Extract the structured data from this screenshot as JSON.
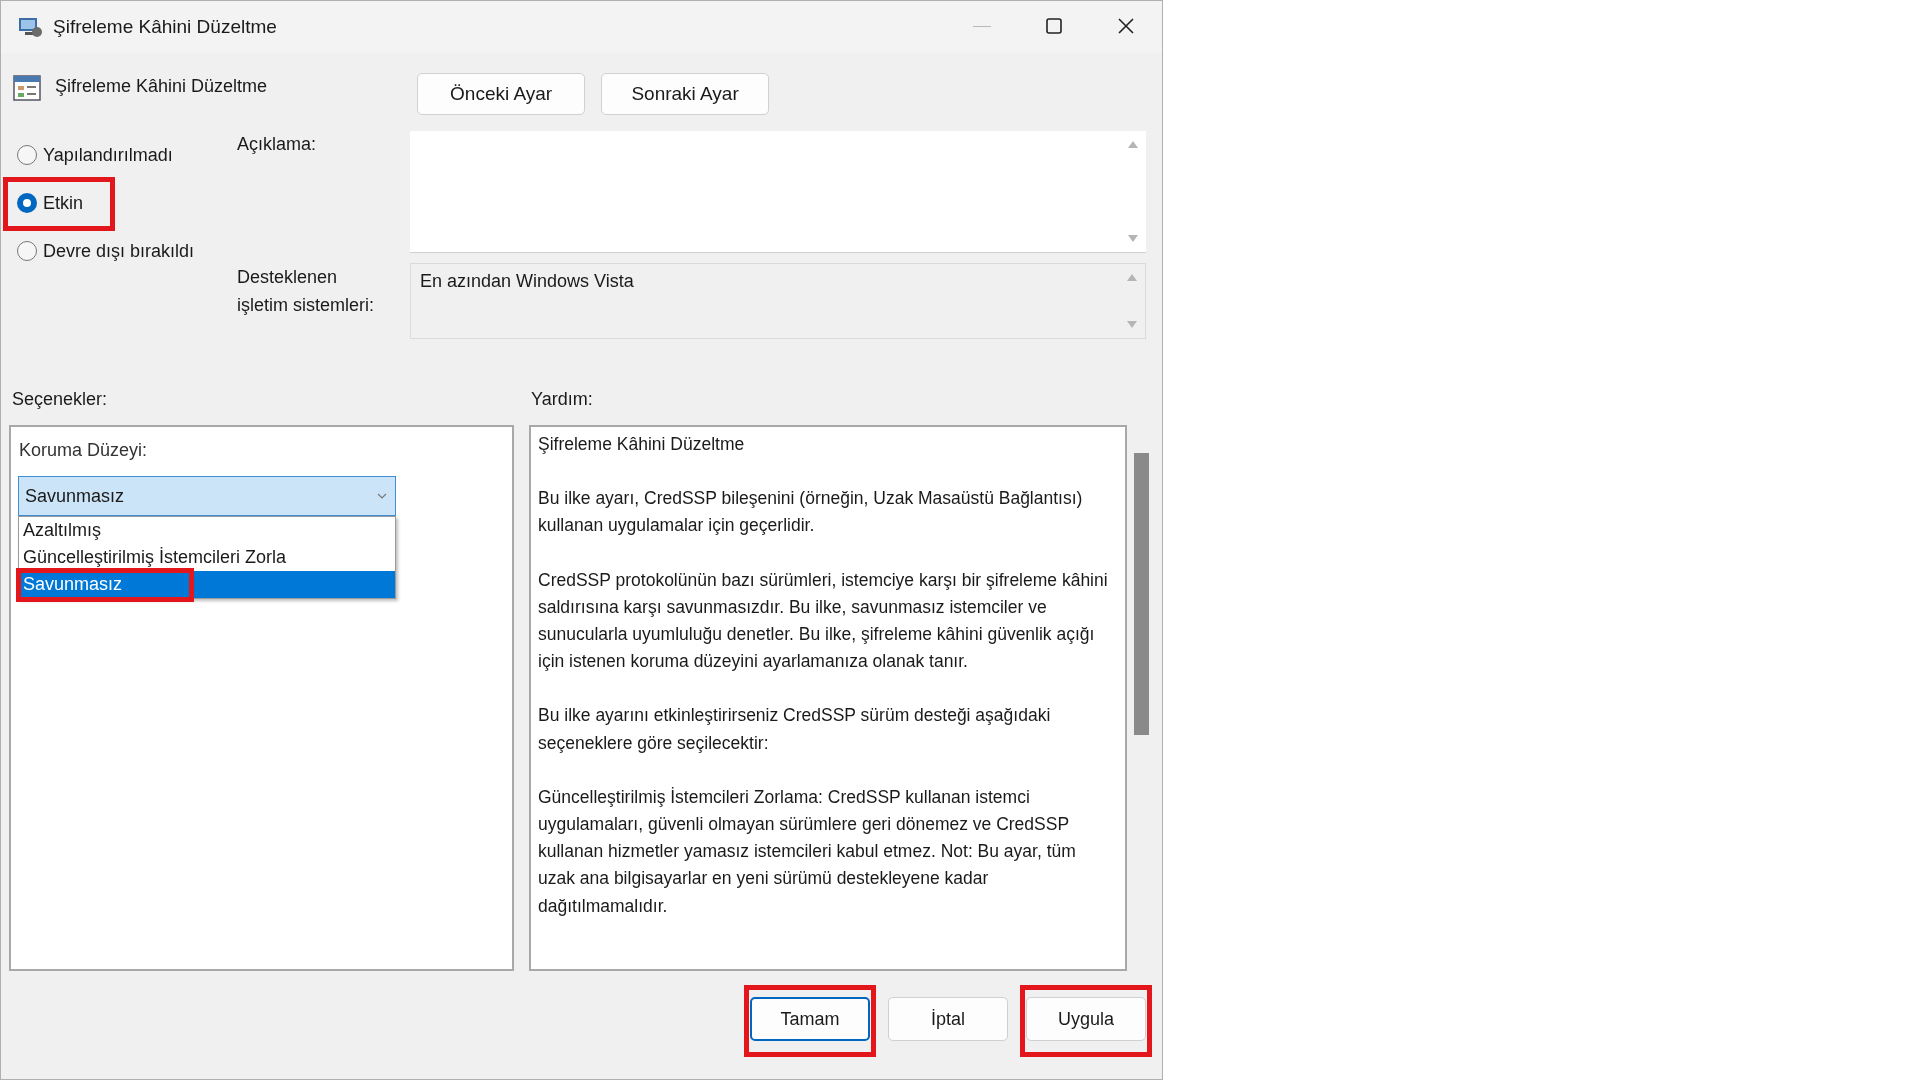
{
  "window": {
    "title": "Şifreleme Kâhini Düzeltme"
  },
  "setting_title": "Şifreleme Kâhini Düzeltme",
  "nav_buttons": [
    "Önceki Ayar",
    "Sonraki Ayar"
  ],
  "state_options": [
    {
      "label": "Yapılandırılmadı",
      "selected": false,
      "highlighted": false
    },
    {
      "label": "Etkin",
      "selected": true,
      "highlighted": true
    },
    {
      "label": "Devre dışı bırakıldı",
      "selected": false,
      "highlighted": false
    }
  ],
  "comment": {
    "label": "Açıklama:"
  },
  "supported": {
    "label": "Desteklenen işletim sistemleri:",
    "value": "En azından Windows Vista"
  },
  "options": {
    "label": "Seçenekler:",
    "field_label": "Koruma Düzeyi:",
    "dropdown": {
      "value": "Savunmasız",
      "expanded": true,
      "items": [
        {
          "label": "Azaltılmış",
          "selected": false,
          "highlighted": false
        },
        {
          "label": "Güncelleştirilmiş İstemcileri Zorla",
          "selected": false,
          "highlighted": false
        },
        {
          "label": "Savunmasız",
          "selected": true,
          "highlighted": true
        }
      ]
    }
  },
  "help": {
    "label": "Yardım:",
    "paragraphs": [
      "Şifreleme Kâhini Düzeltme",
      "Bu ilke ayarı, CredSSP bileşenini (örneğin, Uzak Masaüstü Bağlantısı) kullanan uygulamalar için geçerlidir.",
      "CredSSP protokolünün bazı sürümleri, istemciye karşı bir şifreleme kâhini saldırısına karşı savunmasızdır. Bu ilke, savunmasız istemciler ve sunucularla uyumluluğu denetler. Bu ilke, şifreleme kâhini güvenlik açığı için istenen koruma düzeyini ayarlamanıza olanak tanır.",
      "Bu ilke ayarını etkinleştirirseniz CredSSP sürüm desteği aşağıdaki seçeneklere göre seçilecektir:",
      "Güncelleştirilmiş İstemcileri Zorlama: CredSSP kullanan istemci uygulamaları, güvenli olmayan sürümlere geri dönemez ve CredSSP kullanan hizmetler yamasız istemcileri kabul etmez. Not: Bu ayar, tüm uzak ana bilgisayarlar en yeni sürümü destekleyene kadar dağıtılmamalıdır."
    ]
  },
  "buttons": [
    {
      "label": "Tamam",
      "highlighted": true,
      "default": true
    },
    {
      "label": "İptal",
      "highlighted": false,
      "default": false
    },
    {
      "label": "Uygula",
      "highlighted": true,
      "default": false
    }
  ]
}
